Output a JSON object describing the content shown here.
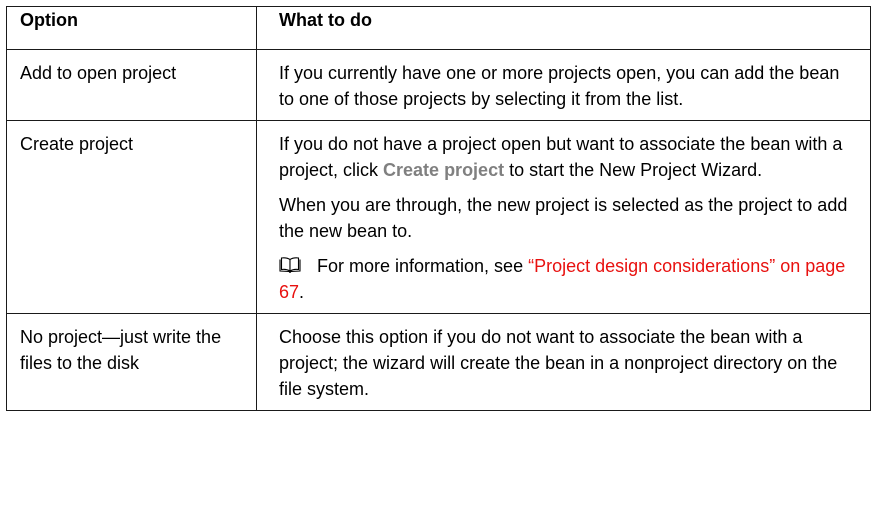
{
  "header": {
    "option": "Option",
    "what_to_do": "What to do"
  },
  "rows": [
    {
      "option": "Add to open project",
      "desc_1": "If you currently have one or more projects open, you can add the bean to one of those projects by selecting it from the list."
    },
    {
      "option": "Create project",
      "desc_pre": "If you do not have a project open but want to associate the bean with a project, click ",
      "desc_term": "Create project",
      "desc_post": " to start the New Project Wizard.",
      "desc_2": "When you are through, the new project is selected as the project to add the new bean to.",
      "note_pre": "For more information, see ",
      "note_link": "“Project design considerations” on page 67",
      "note_post": ".",
      "note_icon": "book-icon"
    },
    {
      "option": "No project—just write the files to the disk",
      "desc_1": "Choose this option if you do not want to associate the bean with a project; the wizard will create the bean in a nonproject directory on the file system."
    }
  ],
  "colors": {
    "link": "#e8110f",
    "ui_term": "#808080",
    "border": "#1a1a1a"
  }
}
